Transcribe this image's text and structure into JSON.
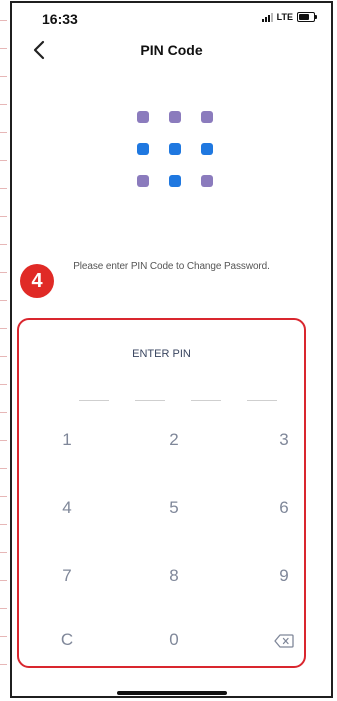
{
  "status_bar": {
    "time": "16:33",
    "network": "LTE"
  },
  "nav": {
    "title": "PIN Code",
    "back_icon": "chevron-left-icon"
  },
  "graphic": {
    "icon": "keypad-grid-icon",
    "colors": {
      "purple": "#8b7bbd",
      "blue": "#1f78e0"
    }
  },
  "instruction": "Please enter PIN Code to Change Password.",
  "step_badge": "4",
  "keypad": {
    "heading": "ENTER PIN",
    "keys": [
      "1",
      "2",
      "3",
      "4",
      "5",
      "6",
      "7",
      "8",
      "9",
      "C",
      "0"
    ],
    "backspace_icon": "backspace-icon"
  },
  "accent_color": "#d9262e"
}
